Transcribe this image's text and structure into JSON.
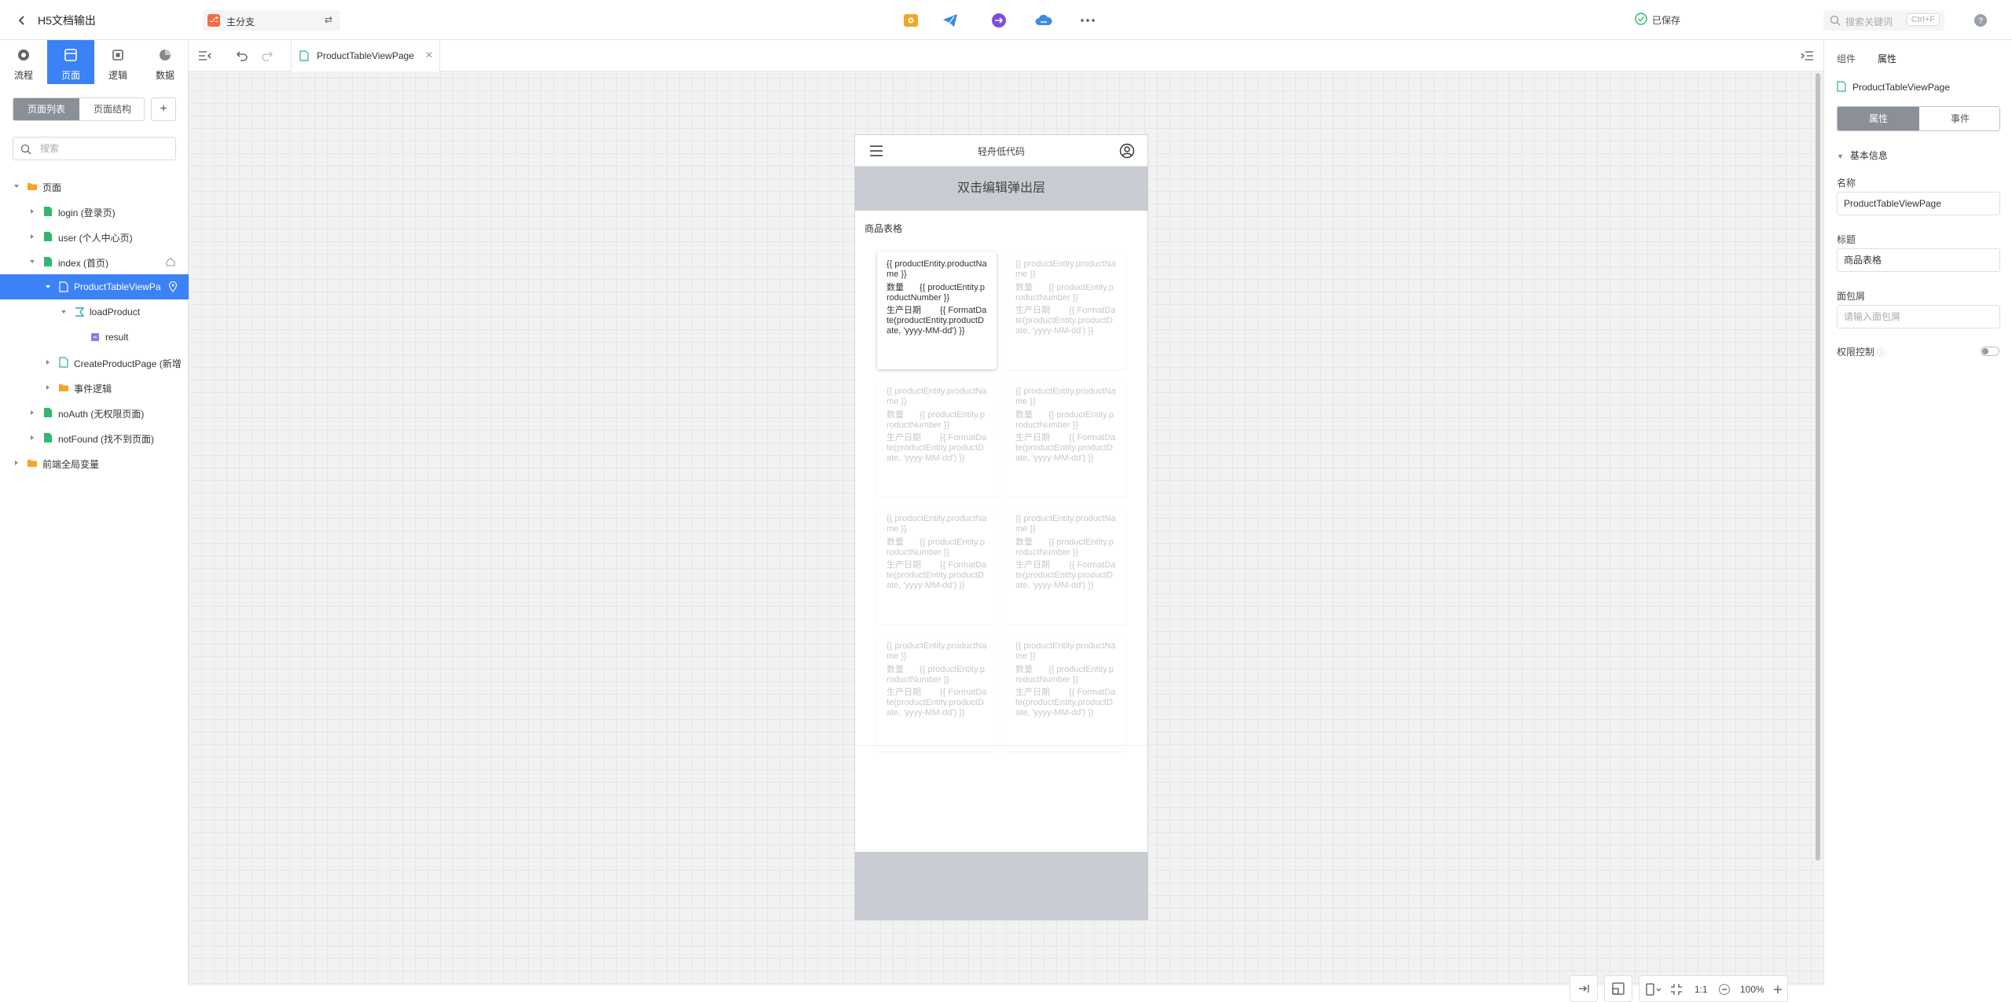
{
  "app": {
    "title": "H5文档输出",
    "branch": "主分支",
    "saved_status": "已保存",
    "search_placeholder": "搜索关键词",
    "search_shortcut": "Ctrl+F"
  },
  "toolbar": {
    "icons": [
      "preview-icon",
      "publish-icon",
      "export-icon",
      "cloud-icon",
      "more-icon"
    ]
  },
  "left_nav": {
    "tabs": [
      {
        "label": "流程",
        "icon": "flow-icon"
      },
      {
        "label": "页面",
        "icon": "page-icon"
      },
      {
        "label": "逻辑",
        "icon": "logic-icon"
      },
      {
        "label": "数据",
        "icon": "data-icon"
      }
    ],
    "active_tab": "页面",
    "segments": [
      "页面列表",
      "页面结构"
    ],
    "search_placeholder": "搜索",
    "tree": [
      {
        "label": "页面",
        "type": "folder"
      },
      {
        "label": "login (登录页)",
        "type": "page"
      },
      {
        "label": "user (个人中心页)",
        "type": "page"
      },
      {
        "label": "index (首页)",
        "type": "page"
      },
      {
        "label": "ProductTableViewPa",
        "type": "page",
        "selected": true
      },
      {
        "label": "loadProduct",
        "type": "logic"
      },
      {
        "label": "result",
        "type": "variable"
      },
      {
        "label": "CreateProductPage (新增",
        "type": "page"
      },
      {
        "label": "事件逻辑",
        "type": "folder"
      },
      {
        "label": "noAuth (无权限页面)",
        "type": "page"
      },
      {
        "label": "notFound (找不到页面)",
        "type": "page"
      },
      {
        "label": "前端全局变量",
        "type": "folder"
      }
    ]
  },
  "editor": {
    "tab_label": "ProductTableViewPage",
    "phone": {
      "header_title": "轻舟低代码",
      "popup_text": "双击编辑弹出层",
      "section_title": "商品表格",
      "card": {
        "name": "{{ productEntity.productName }}",
        "qty_label": "数量",
        "qty_value": "{{ productEntity.productNumber }}",
        "date_label": "生产日期",
        "date_value": "{{ FormatDate(productEntity.productDate, 'yyyy-MM-dd') }}"
      }
    },
    "zoom": {
      "ratio": "1:1",
      "percent": "100%"
    }
  },
  "right_panel": {
    "tabs": [
      "组件",
      "属性"
    ],
    "active_tab": "属性",
    "component_name": "ProductTableViewPage",
    "segments": [
      "属性",
      "事件"
    ],
    "section": "基本信息",
    "fields": {
      "name_label": "名称",
      "name_value": "ProductTableViewPage",
      "title_label": "标题",
      "title_value": "商品表格",
      "crumb_label": "面包屑",
      "crumb_placeholder": "请输入面包屑",
      "auth_label": "权限控制"
    }
  }
}
